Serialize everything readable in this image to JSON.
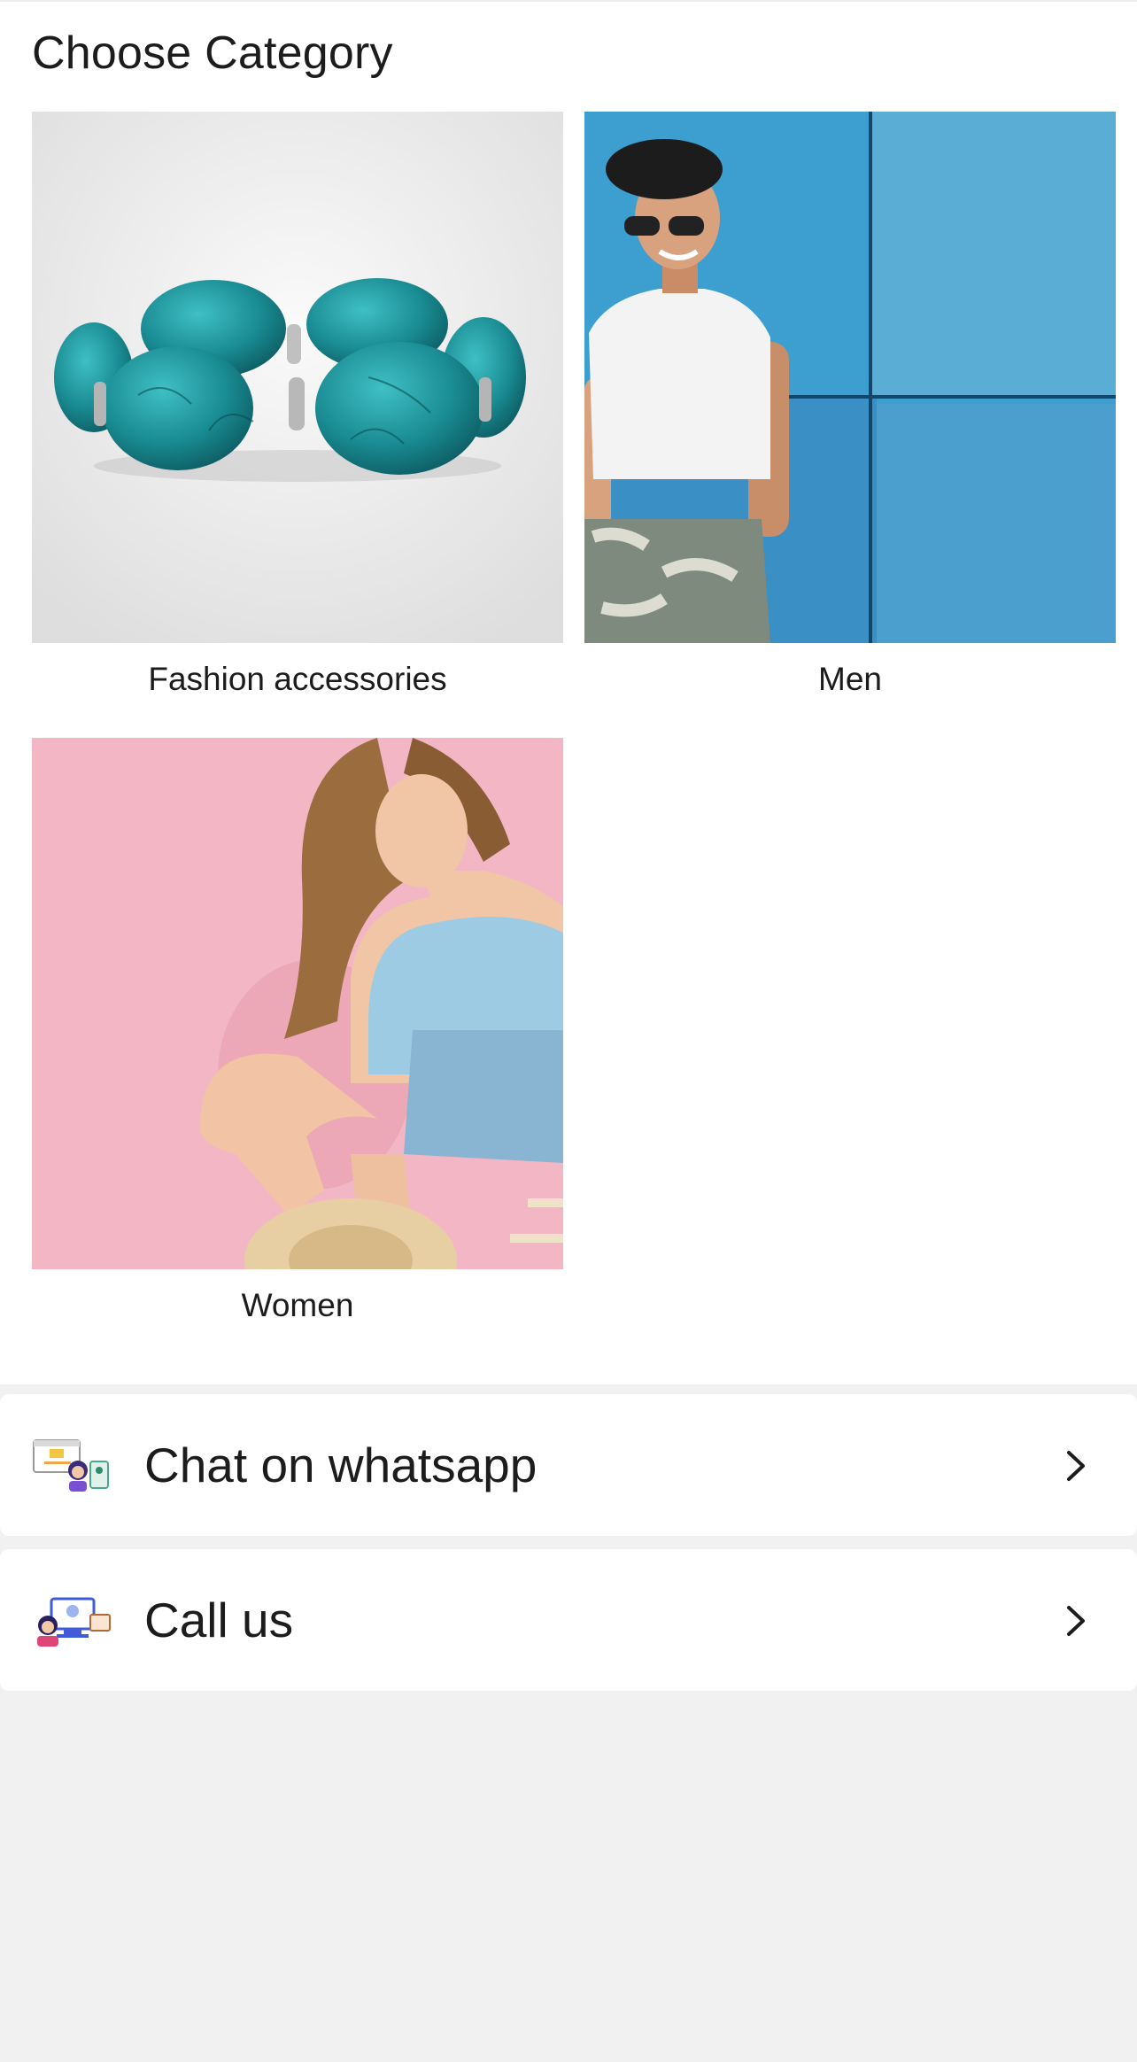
{
  "page": {
    "title": "Choose Category"
  },
  "categories": [
    {
      "label": "Fashion accessories",
      "image": "turquoise-bracelet-photo"
    },
    {
      "label": "Men",
      "image": "man-blue-wall-photo"
    },
    {
      "label": "Women",
      "image": "woman-pink-background-photo"
    }
  ],
  "contact": [
    {
      "label": "Chat on whatsapp",
      "icon": "chat-support-icon"
    },
    {
      "label": "Call us",
      "icon": "call-support-icon"
    }
  ],
  "colors": {
    "background": "#f1f1f1",
    "card": "#ffffff",
    "text": "#1c1c1c"
  }
}
